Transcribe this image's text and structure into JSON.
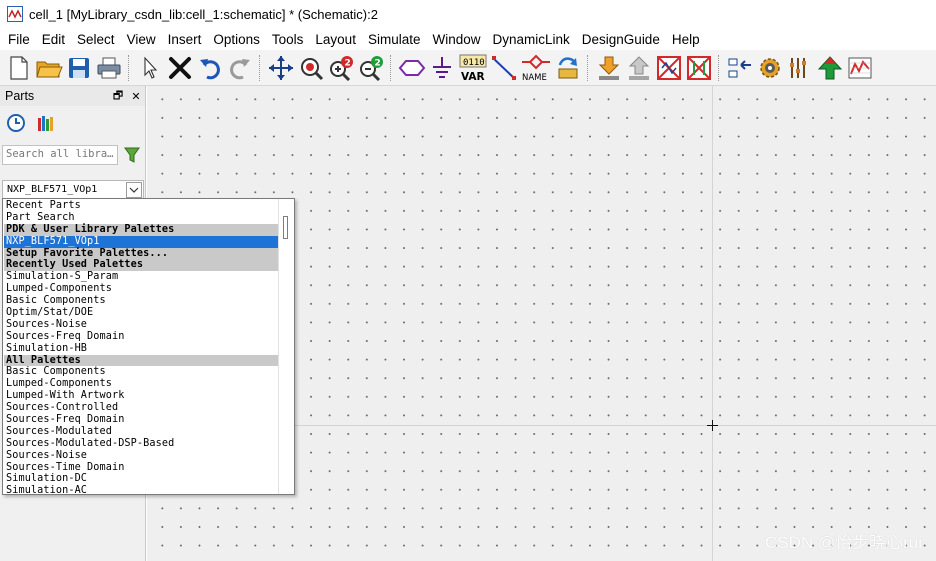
{
  "window": {
    "title": "cell_1 [MyLibrary_csdn_lib:cell_1:schematic] * (Schematic):2"
  },
  "menu": [
    "File",
    "Edit",
    "Select",
    "View",
    "Insert",
    "Options",
    "Tools",
    "Layout",
    "Simulate",
    "Window",
    "DynamicLink",
    "DesignGuide",
    "Help"
  ],
  "toolbar": {
    "var_label": "VAR",
    "var_bits": "0110",
    "name_label": "NAME"
  },
  "parts_panel": {
    "title": "Parts",
    "float_glyph": "🗗",
    "close_glyph": "✕",
    "search_placeholder": "Search all libra…",
    "selected_palette": "NXP_BLF571_VOp1"
  },
  "dropdown": {
    "items": [
      {
        "label": "Recent Parts",
        "kind": "normal"
      },
      {
        "label": "Part Search",
        "kind": "normal"
      },
      {
        "label": "PDK & User Library Palettes",
        "kind": "header"
      },
      {
        "label": "NXP_BLF571_VOp1",
        "kind": "selected"
      },
      {
        "label": "Setup Favorite Palettes...",
        "kind": "header"
      },
      {
        "label": "Recently Used Palettes",
        "kind": "header"
      },
      {
        "label": "Simulation-S_Param",
        "kind": "normal"
      },
      {
        "label": "Lumped-Components",
        "kind": "normal"
      },
      {
        "label": "Basic Components",
        "kind": "normal"
      },
      {
        "label": "Optim/Stat/DOE",
        "kind": "normal"
      },
      {
        "label": "Sources-Noise",
        "kind": "normal"
      },
      {
        "label": "Sources-Freq Domain",
        "kind": "normal"
      },
      {
        "label": "Simulation-HB",
        "kind": "normal"
      },
      {
        "label": "All Palettes",
        "kind": "header"
      },
      {
        "label": "Basic Components",
        "kind": "normal"
      },
      {
        "label": "Lumped-Components",
        "kind": "normal"
      },
      {
        "label": "Lumped-With Artwork",
        "kind": "normal"
      },
      {
        "label": "Sources-Controlled",
        "kind": "normal"
      },
      {
        "label": "Sources-Freq Domain",
        "kind": "normal"
      },
      {
        "label": "Sources-Modulated",
        "kind": "normal"
      },
      {
        "label": "Sources-Modulated-DSP-Based",
        "kind": "normal"
      },
      {
        "label": "Sources-Noise",
        "kind": "normal"
      },
      {
        "label": "Sources-Time Domain",
        "kind": "normal"
      },
      {
        "label": "Simulation-DC",
        "kind": "normal"
      },
      {
        "label": "Simulation-AC",
        "kind": "normal"
      }
    ]
  },
  "watermark": "CSDN @怡步晓心rui",
  "colors": {
    "selection": "#1e73d6",
    "header_row": "#c9c9c9",
    "canvas": "#f0efef"
  }
}
